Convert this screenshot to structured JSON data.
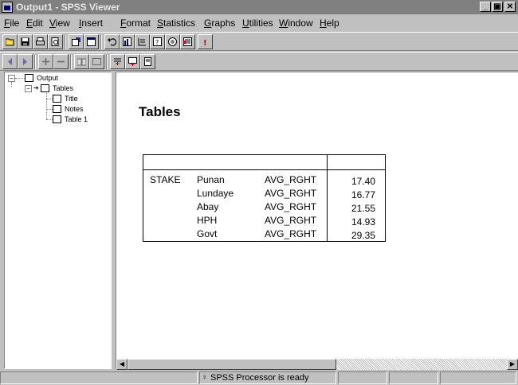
{
  "window": {
    "title": "Output1 - SPSS Viewer",
    "minimize_label": "_",
    "maximize_label": "▣",
    "close_label": "✕"
  },
  "menu": [
    "File",
    "Edit",
    "View",
    "Insert",
    "Format",
    "Statistics",
    "Graphs",
    "Utilities",
    "Window",
    "Help"
  ],
  "toolbar": {
    "row1_icons": [
      "open-icon",
      "save-icon",
      "print-icon",
      "print-preview-icon",
      "export-icon",
      "recall-dialog-icon",
      "undo-icon",
      "goto-chart-icon",
      "goto-case-icon",
      "variables-icon",
      "use-sets-icon",
      "select-last-output-icon",
      "designate-window-icon"
    ],
    "row2_icons": [
      "promote-icon",
      "demote-icon",
      "expand-icon",
      "collapse-icon",
      "show-icon",
      "hide-icon",
      "insert-heading-icon",
      "insert-title-icon",
      "insert-text-icon"
    ]
  },
  "outline": {
    "root": "Output",
    "group": "Tables",
    "children": [
      "Title",
      "Notes",
      "Table 1"
    ]
  },
  "content": {
    "heading": "Tables",
    "row_group_label": "STAKE",
    "rows": [
      {
        "name": "Punan",
        "var": "AVG_RGHT",
        "value": "17.40"
      },
      {
        "name": "Lundaye",
        "var": "AVG_RGHT",
        "value": "16.77"
      },
      {
        "name": "Abay",
        "var": "AVG_RGHT",
        "value": "21.55"
      },
      {
        "name": "HPH",
        "var": "AVG_RGHT",
        "value": "14.93"
      },
      {
        "name": "Govt",
        "var": "AVG_RGHT",
        "value": "29.35"
      }
    ]
  },
  "status": {
    "text": "SPSS Processor is ready"
  }
}
